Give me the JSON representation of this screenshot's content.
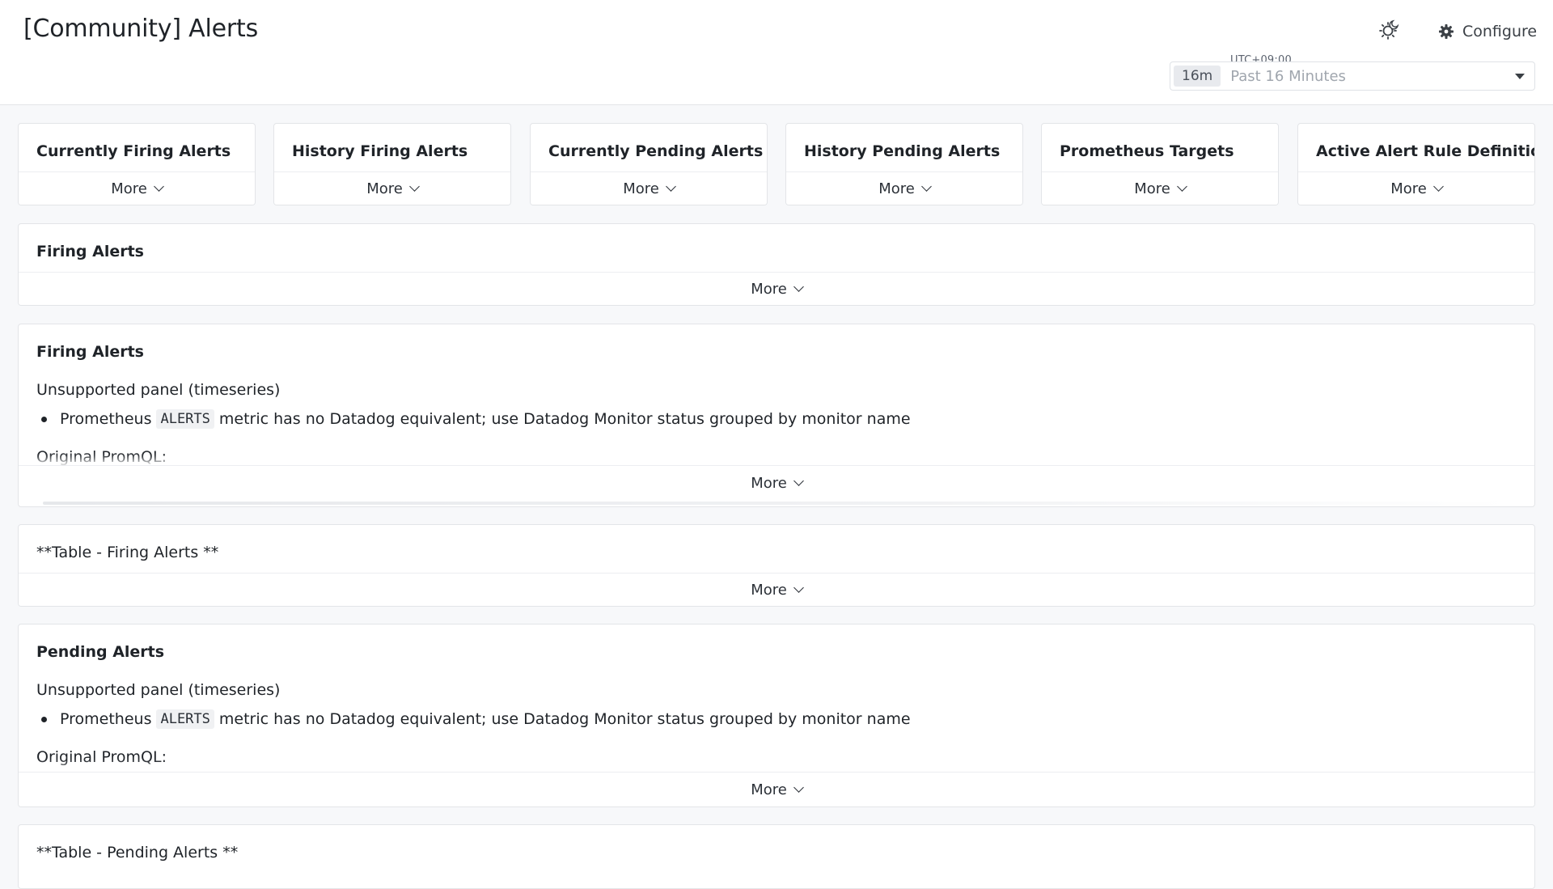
{
  "header": {
    "title": "[Community] Alerts",
    "configure_label": "Configure",
    "timezone": "UTC+09:00",
    "time_badge": "16m",
    "time_range": "Past 16 Minutes"
  },
  "icons": {
    "theme": "theme-toggle-icon",
    "configure": "gear-icon",
    "dropdown": "caret-down-icon",
    "more": "chevron-down-icon"
  },
  "more_label": "More",
  "summary_widgets": [
    {
      "title": "Currently Firing Alerts"
    },
    {
      "title": "History Firing Alerts"
    },
    {
      "title": "Currently Pending Alerts"
    },
    {
      "title": "History Pending Alerts"
    },
    {
      "title": "Prometheus Targets"
    },
    {
      "title": "Active Alert Rule Definitions"
    }
  ],
  "panels": {
    "firing_alerts_summary": {
      "title": "Firing Alerts"
    },
    "firing_alerts": {
      "title": "Firing Alerts",
      "unsupported": "Unsupported panel (timeseries)",
      "bullet_prefix": "Prometheus",
      "bullet_code": "ALERTS",
      "bullet_suffix": "metric has no Datadog equivalent; use Datadog Monitor status grouped by monitor name",
      "promql_label": "Original PromQL:"
    },
    "table_firing": {
      "title": "**Table - Firing Alerts **"
    },
    "pending_alerts": {
      "title": "Pending Alerts",
      "unsupported": "Unsupported panel (timeseries)",
      "bullet_prefix": "Prometheus",
      "bullet_code": "ALERTS",
      "bullet_suffix": "metric has no Datadog equivalent; use Datadog Monitor status grouped by monitor name",
      "promql_label": "Original PromQL:"
    },
    "table_pending": {
      "title": "**Table - Pending Alerts **"
    }
  }
}
